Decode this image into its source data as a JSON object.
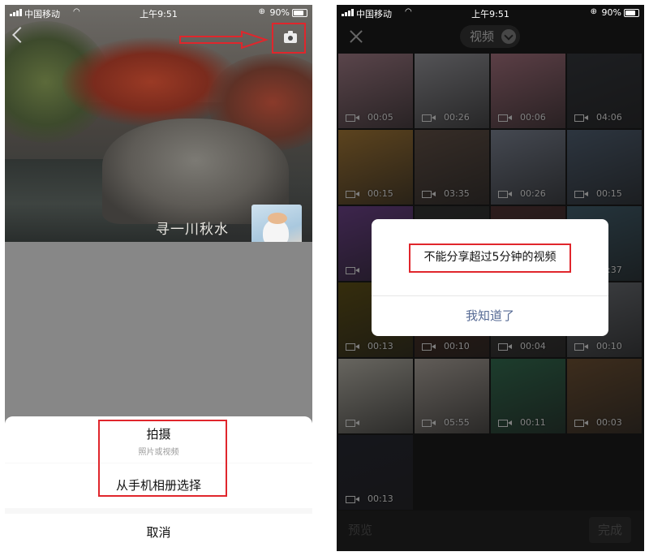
{
  "colors": {
    "highlight": "#e0262c",
    "link": "#576b95"
  },
  "left": {
    "status": {
      "carrier": "中国移动",
      "time": "上午9:51",
      "battery": "90%"
    },
    "icons": {
      "back": "back-arrow-icon",
      "camera": "camera-icon"
    },
    "cover": {
      "nickname": "寻一川秋水"
    },
    "sheet": {
      "shoot_title": "拍摄",
      "shoot_subtitle": "照片或视频",
      "album": "从手机相册选择",
      "cancel": "取消"
    }
  },
  "right": {
    "status": {
      "carrier": "中国移动",
      "time": "上午9:51",
      "battery": "90%"
    },
    "filter_label": "视频",
    "tiles": [
      {
        "duration": "00:05",
        "color": "#b48a96"
      },
      {
        "duration": "00:26",
        "color": "#a8a7ad"
      },
      {
        "duration": "00:06",
        "color": "#b77e8c"
      },
      {
        "duration": "04:06",
        "color": "#3a3d43"
      },
      {
        "duration": "00:15",
        "color": "#b8873d"
      },
      {
        "duration": "03:35",
        "color": "#6d5a4f"
      },
      {
        "duration": "00:26",
        "color": "#8a92a3"
      },
      {
        "duration": "00:15",
        "color": "#5a6b7f"
      },
      {
        "duration": "",
        "color": "#7a4a9a"
      },
      {
        "duration": "",
        "color": "#3a3b3a"
      },
      {
        "duration": "",
        "color": "#5a3a3a"
      },
      {
        "duration": "00:37",
        "color": "#4a6a7a"
      },
      {
        "duration": "00:13",
        "color": "#6a5a1a"
      },
      {
        "duration": "00:10",
        "color": "#5c3a2a"
      },
      {
        "duration": "00:04",
        "color": "#4d4a48"
      },
      {
        "duration": "00:10",
        "color": "#7a7e84"
      },
      {
        "duration": "",
        "color": "#cfcbbf"
      },
      {
        "duration": "05:55",
        "color": "#c2b9b0"
      },
      {
        "duration": "00:11",
        "color": "#3a7a5a"
      },
      {
        "duration": "00:03",
        "color": "#7a5a3a"
      },
      {
        "duration": "00:13",
        "color": "#2b2c38"
      }
    ],
    "dialog": {
      "message": "不能分享超过5分钟的视频",
      "confirm": "我知道了"
    },
    "bottom": {
      "preview": "预览",
      "done": "完成"
    }
  }
}
